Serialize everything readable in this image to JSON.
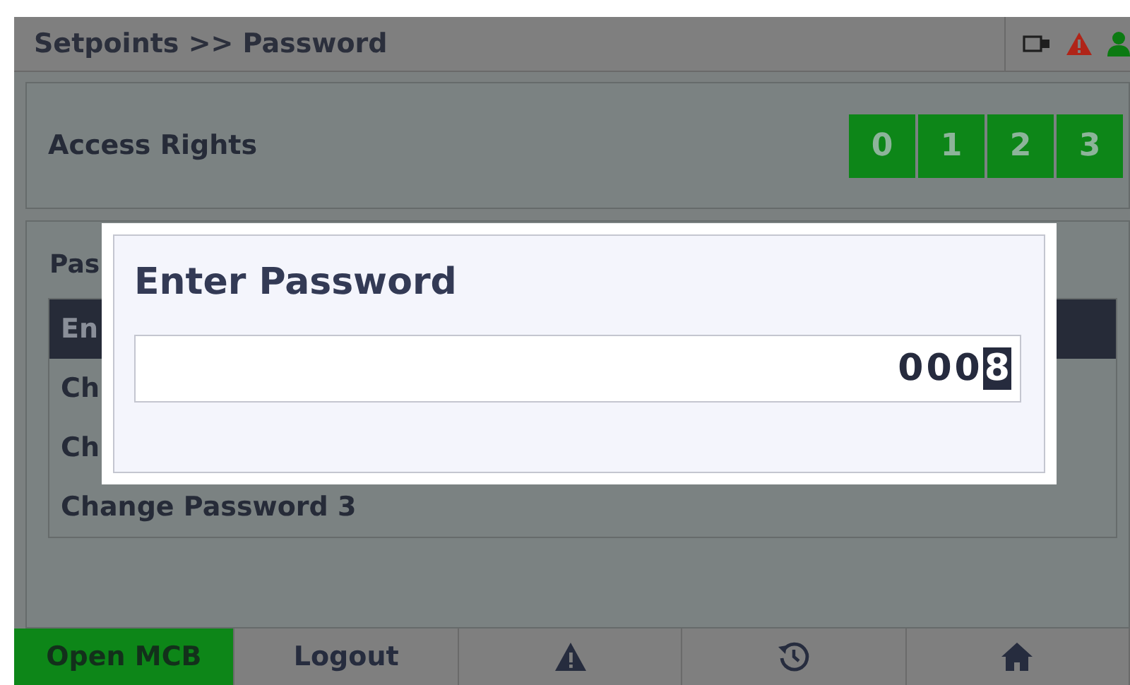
{
  "header": {
    "title": "Setpoints >> Password",
    "status_icons": [
      {
        "kind": "usb"
      },
      {
        "kind": "alarm"
      },
      {
        "kind": "user"
      }
    ]
  },
  "access_rights": {
    "label": "Access Rights",
    "levels": [
      {
        "label": "0",
        "granted": true
      },
      {
        "label": "1",
        "granted": true
      },
      {
        "label": "2",
        "granted": true
      },
      {
        "label": "3",
        "granted": true
      }
    ]
  },
  "password_panel": {
    "title": "Pas",
    "items": [
      {
        "label": "En",
        "selected": true
      },
      {
        "label": "Ch",
        "selected": false
      },
      {
        "label": "Ch",
        "selected": false
      },
      {
        "label": "Change Password 3",
        "selected": false
      }
    ]
  },
  "dialog": {
    "title": "Enter Password",
    "value": "000",
    "cursor_digit": "8"
  },
  "footer": [
    {
      "kind": "text",
      "label": "Open MCB",
      "active": true
    },
    {
      "kind": "text",
      "label": "Logout",
      "active": false
    },
    {
      "kind": "alarm",
      "active": false
    },
    {
      "kind": "history",
      "active": false
    },
    {
      "kind": "home",
      "active": false
    }
  ]
}
